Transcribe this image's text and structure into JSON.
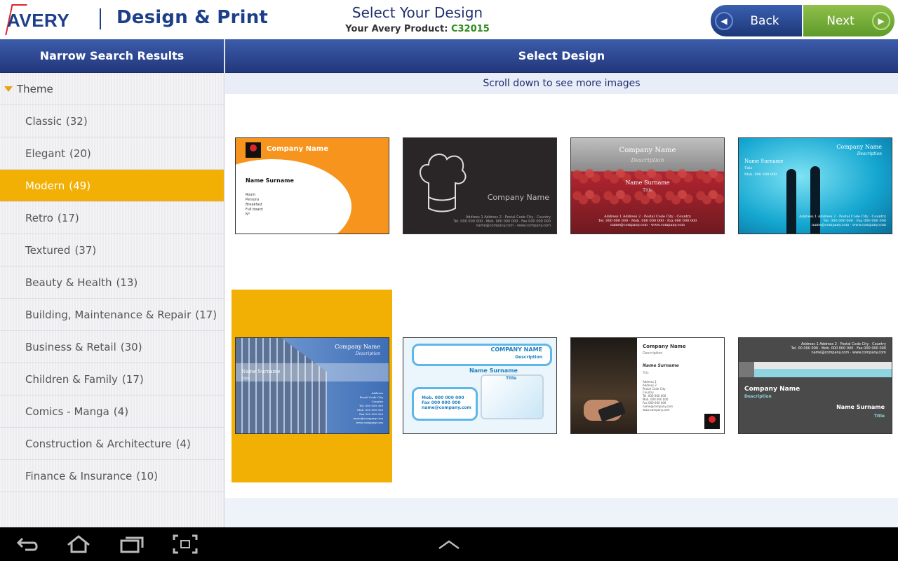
{
  "header": {
    "logo_text": "AVERY",
    "app_title": "Design & Print",
    "title": "Select Your Design",
    "product_label": "Your Avery Product:",
    "product_code": "C32015",
    "back_label": "Back",
    "next_label": "Next"
  },
  "sidebar": {
    "title": "Narrow Search Results",
    "group_label": "Theme",
    "items": [
      {
        "label": "Classic",
        "count": "(32)"
      },
      {
        "label": "Elegant",
        "count": "(20)"
      },
      {
        "label": "Modern",
        "count": "(49)"
      },
      {
        "label": "Retro",
        "count": "(17)"
      },
      {
        "label": "Textured",
        "count": "(37)"
      },
      {
        "label": "Beauty & Health",
        "count": "(13)"
      },
      {
        "label": "Building, Maintenance & Repair",
        "count": "(17)"
      },
      {
        "label": "Business & Retail",
        "count": "(30)"
      },
      {
        "label": "Children & Family",
        "count": "(17)"
      },
      {
        "label": "Comics - Manga",
        "count": "(4)"
      },
      {
        "label": "Construction & Architecture",
        "count": "(4)"
      },
      {
        "label": "Finance & Insurance",
        "count": "(10)"
      }
    ],
    "selected_index": 2
  },
  "main": {
    "title": "Select Design",
    "hint": "Scroll down to see more images",
    "selected_card": 4
  },
  "cards": {
    "c1": {
      "company": "Company Name",
      "name": "Name Surname",
      "logo": "LOGO",
      "lines": [
        "Room",
        "Persons",
        "Breakfast",
        "Full board",
        "N°"
      ]
    },
    "c2": {
      "company": "Company Name",
      "addr1": "Address 1 Address 2 · Postal Code City · Country",
      "addr2": "Tel. 000 000 000 · Mob. 000 000 000 · Fax 000 000 000",
      "addr3": "name@company.com · www.company.com"
    },
    "c3": {
      "company": "Company Name",
      "desc": "Description",
      "name": "Name Surname",
      "title": "Title",
      "addr1": "Address 1 Address 2 · Postal Code City · Country",
      "addr2": "Tel. 000 000 000 · Mob. 000 000 000 · Fax 000 000 000",
      "addr3": "name@company.com · www.company.com"
    },
    "c4": {
      "company": "Company Name",
      "desc": "Description",
      "name": "Name Surname",
      "title": "Title",
      "mob": "Mob. 000 000 000",
      "addr1": "Address 1 Address 2 · Postal Code City · Country",
      "addr2": "Tel. 000 000 000 · Fax 000 000 000",
      "addr3": "name@company.com · www.company.com"
    },
    "c5": {
      "company": "Company Name",
      "desc": "Description",
      "name": "Name Surname",
      "title": "Title",
      "lines": [
        "Address",
        "Postal Code City",
        "Country",
        "Tel. 000 000 000",
        "Mob. 000 000 000",
        "Fax 000 000 000",
        "name@company.com",
        "www.company.com"
      ]
    },
    "c6": {
      "company": "COMPANY NAME",
      "desc": "Description",
      "name": "Name Surname",
      "title": "Title",
      "mob": "Mob. 000 000 000",
      "fax": "Fax 000 000 000",
      "email": "name@company.com"
    },
    "c7": {
      "company": "Company Name",
      "desc": "Description",
      "name": "Name Surname",
      "title": "Title",
      "lines": [
        "Address 1",
        "Address 2",
        "Postal Code City",
        "Country",
        "Tel. 000 000 000",
        "Mob. 000 000 000",
        "Fax 000 000 000",
        "name@company.com",
        "www.company.com"
      ],
      "logo": "LOGO"
    },
    "c8": {
      "addr1": "Address 1 Address 2 · Postal Code City · Country",
      "addr2": "Tel. 00 000 000 · Mob. 000 000 000 · Fax 000 000 000",
      "addr3": "name@company.com · www.company.com",
      "company": "Company Name",
      "desc": "Description",
      "name": "Name Surname",
      "title": "Title"
    }
  },
  "colors": {
    "brand_blue": "#1d3f8a",
    "selection_yellow": "#f2b005",
    "next_green": "#6fac35",
    "product_code_green": "#2d8b1f"
  },
  "navbar": {
    "icons": [
      "back-icon",
      "home-icon",
      "recent-apps-icon",
      "screenshot-icon",
      "chevron-up-icon"
    ]
  }
}
